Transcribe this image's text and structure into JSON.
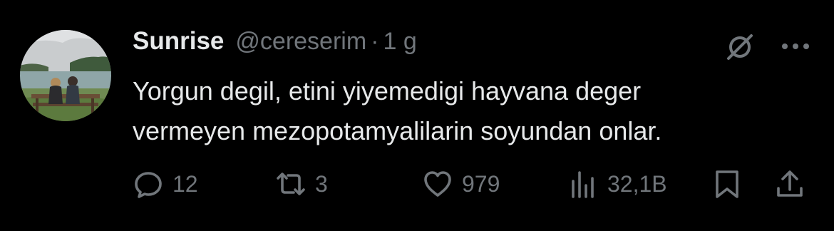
{
  "author": {
    "display_name": "Sunrise",
    "handle": "@cereserim",
    "separator": "·",
    "time": "1 g"
  },
  "tweet": {
    "line1": "Yorgun degil, etini yiyemedigi hayvana deger",
    "line2": "vermeyen mezopotamyalilarin soyundan onlar."
  },
  "actions": {
    "replies": "12",
    "retweets": "3",
    "likes": "979",
    "views": "32,1B"
  },
  "icons": {
    "grok": "grok-icon",
    "more": "more-icon",
    "reply": "reply-icon",
    "retweet": "retweet-icon",
    "like": "heart-icon",
    "views": "views-icon",
    "bookmark": "bookmark-icon",
    "share": "share-icon"
  },
  "colors": {
    "background": "#000000",
    "primary_text": "#e7e9ea",
    "secondary_text": "#71767b"
  }
}
